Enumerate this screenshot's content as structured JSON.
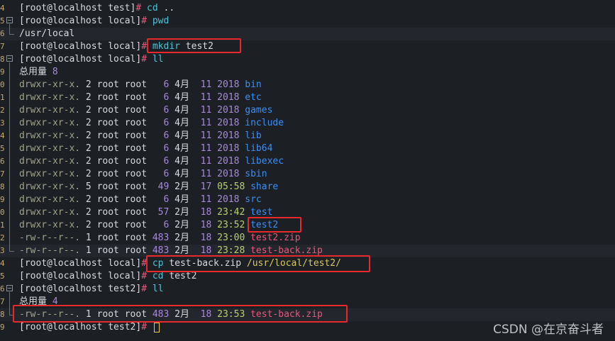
{
  "gutter": [
    "4",
    "5",
    "6",
    "7",
    "8",
    "9",
    "0",
    "1",
    "2",
    "3",
    "4",
    "5",
    "6",
    "7",
    "8",
    "9",
    "0",
    "1",
    "2",
    "3",
    "4",
    "5",
    "6",
    "7",
    "8",
    "9"
  ],
  "lines": [
    {
      "type": "prompt",
      "user": "[root@localhost test]",
      "sym": "#",
      "cmd": "cd ..",
      "fold": "",
      "sel": false
    },
    {
      "type": "prompt",
      "user": "[root@localhost local]",
      "sym": "#",
      "cmd": "pwd",
      "fold": "open",
      "sel": false
    },
    {
      "type": "output",
      "text": "/usr/local",
      "fold": "end",
      "sel": true
    },
    {
      "type": "prompt",
      "user": "[root@localhost local]",
      "sym": "#",
      "cmd": "mkdir test2",
      "fold": "",
      "sel": false
    },
    {
      "type": "prompt",
      "user": "[root@localhost local]",
      "sym": "#",
      "cmd": "ll",
      "fold": "open",
      "sel": false
    },
    {
      "type": "total",
      "label": "总用量",
      "num": "8"
    },
    {
      "type": "entry",
      "perm": "drwxr-xr-x.",
      "links": "2",
      "owner": "root root",
      "size": "6",
      "month": "4月",
      "day": "11",
      "time": "2018",
      "name": "bin",
      "kind": "dir"
    },
    {
      "type": "entry",
      "perm": "drwxr-xr-x.",
      "links": "2",
      "owner": "root root",
      "size": "6",
      "month": "4月",
      "day": "11",
      "time": "2018",
      "name": "etc",
      "kind": "dir"
    },
    {
      "type": "entry",
      "perm": "drwxr-xr-x.",
      "links": "2",
      "owner": "root root",
      "size": "6",
      "month": "4月",
      "day": "11",
      "time": "2018",
      "name": "games",
      "kind": "dir"
    },
    {
      "type": "entry",
      "perm": "drwxr-xr-x.",
      "links": "2",
      "owner": "root root",
      "size": "6",
      "month": "4月",
      "day": "11",
      "time": "2018",
      "name": "include",
      "kind": "dir"
    },
    {
      "type": "entry",
      "perm": "drwxr-xr-x.",
      "links": "2",
      "owner": "root root",
      "size": "6",
      "month": "4月",
      "day": "11",
      "time": "2018",
      "name": "lib",
      "kind": "dir"
    },
    {
      "type": "entry",
      "perm": "drwxr-xr-x.",
      "links": "2",
      "owner": "root root",
      "size": "6",
      "month": "4月",
      "day": "11",
      "time": "2018",
      "name": "lib64",
      "kind": "dir"
    },
    {
      "type": "entry",
      "perm": "drwxr-xr-x.",
      "links": "2",
      "owner": "root root",
      "size": "6",
      "month": "4月",
      "day": "11",
      "time": "2018",
      "name": "libexec",
      "kind": "dir"
    },
    {
      "type": "entry",
      "perm": "drwxr-xr-x.",
      "links": "2",
      "owner": "root root",
      "size": "6",
      "month": "4月",
      "day": "11",
      "time": "2018",
      "name": "sbin",
      "kind": "dir"
    },
    {
      "type": "entry",
      "perm": "drwxr-xr-x.",
      "links": "5",
      "owner": "root root",
      "size": "49",
      "month": "2月",
      "day": "17",
      "time": "05:58",
      "name": "share",
      "kind": "dir"
    },
    {
      "type": "entry",
      "perm": "drwxr-xr-x.",
      "links": "2",
      "owner": "root root",
      "size": "6",
      "month": "4月",
      "day": "11",
      "time": "2018",
      "name": "src",
      "kind": "dir"
    },
    {
      "type": "entry",
      "perm": "drwxr-xr-x.",
      "links": "2",
      "owner": "root root",
      "size": "57",
      "month": "2月",
      "day": "18",
      "time": "23:42",
      "name": "test",
      "kind": "dir"
    },
    {
      "type": "entry",
      "perm": "drwxr-xr-x.",
      "links": "2",
      "owner": "root root",
      "size": "6",
      "month": "2月",
      "day": "18",
      "time": "23:52",
      "name": "test2",
      "kind": "dir"
    },
    {
      "type": "entry",
      "perm": "-rw-r--r--.",
      "links": "1",
      "owner": "root root",
      "size": "483",
      "month": "2月",
      "day": "18",
      "time": "23:00",
      "name": "test2.zip",
      "kind": "zip"
    },
    {
      "type": "entry",
      "perm": "-rw-r--r--.",
      "links": "1",
      "owner": "root root",
      "size": "483",
      "month": "2月",
      "day": "18",
      "time": "23:28",
      "name": "test-back.zip",
      "kind": "zip",
      "fold": "end",
      "sel": true
    },
    {
      "type": "prompt",
      "user": "[root@localhost local]",
      "sym": "#",
      "cmd": "cp test-back.zip /usr/local/test2/",
      "fold": "",
      "sel": false,
      "cmdColor": "yellow"
    },
    {
      "type": "prompt",
      "user": "[root@localhost local]",
      "sym": "#",
      "cmd": "cd test2",
      "fold": "",
      "sel": false
    },
    {
      "type": "prompt",
      "user": "[root@localhost test2]",
      "sym": "#",
      "cmd": "ll",
      "fold": "open",
      "sel": false
    },
    {
      "type": "total",
      "label": "总用量",
      "num": "4"
    },
    {
      "type": "entry",
      "perm": "-rw-r--r--.",
      "links": "1",
      "owner": "root root",
      "size": "483",
      "month": "2月",
      "day": "18",
      "time": "23:53",
      "name": "test-back.zip",
      "kind": "zip",
      "fold": "end",
      "sel": true
    },
    {
      "type": "prompt",
      "user": "[root@localhost test2]",
      "sym": "#",
      "cmd": "",
      "fold": "",
      "sel": false,
      "cursor": true
    }
  ],
  "watermark": "CSDN @在京奋斗者",
  "colors": {
    "highlight_box": "#e8282b",
    "background": "#1c1f24"
  }
}
